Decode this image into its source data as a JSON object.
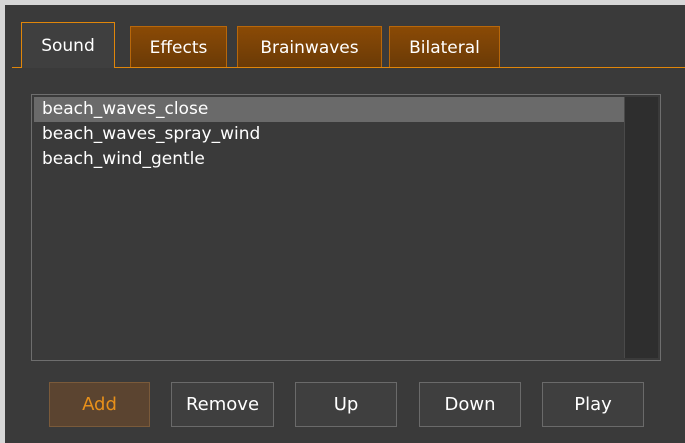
{
  "tabs": [
    {
      "label": "Sound",
      "active": true
    },
    {
      "label": "Effects",
      "active": false
    },
    {
      "label": "Brainwaves",
      "active": false
    },
    {
      "label": "Bilateral",
      "active": false
    }
  ],
  "sound_list": {
    "items": [
      "beach_waves_close",
      "beach_waves_spray_wind",
      "beach_wind_gentle"
    ],
    "selected": "beach_waves_close"
  },
  "buttons": {
    "add": "Add",
    "remove": "Remove",
    "up": "Up",
    "down": "Down",
    "play": "Play"
  },
  "colors": {
    "accent": "#e0860a",
    "panel_bg": "#3a3a3a",
    "inactive_tab": "#7a4206",
    "selected_row": "#6a6a6a"
  }
}
